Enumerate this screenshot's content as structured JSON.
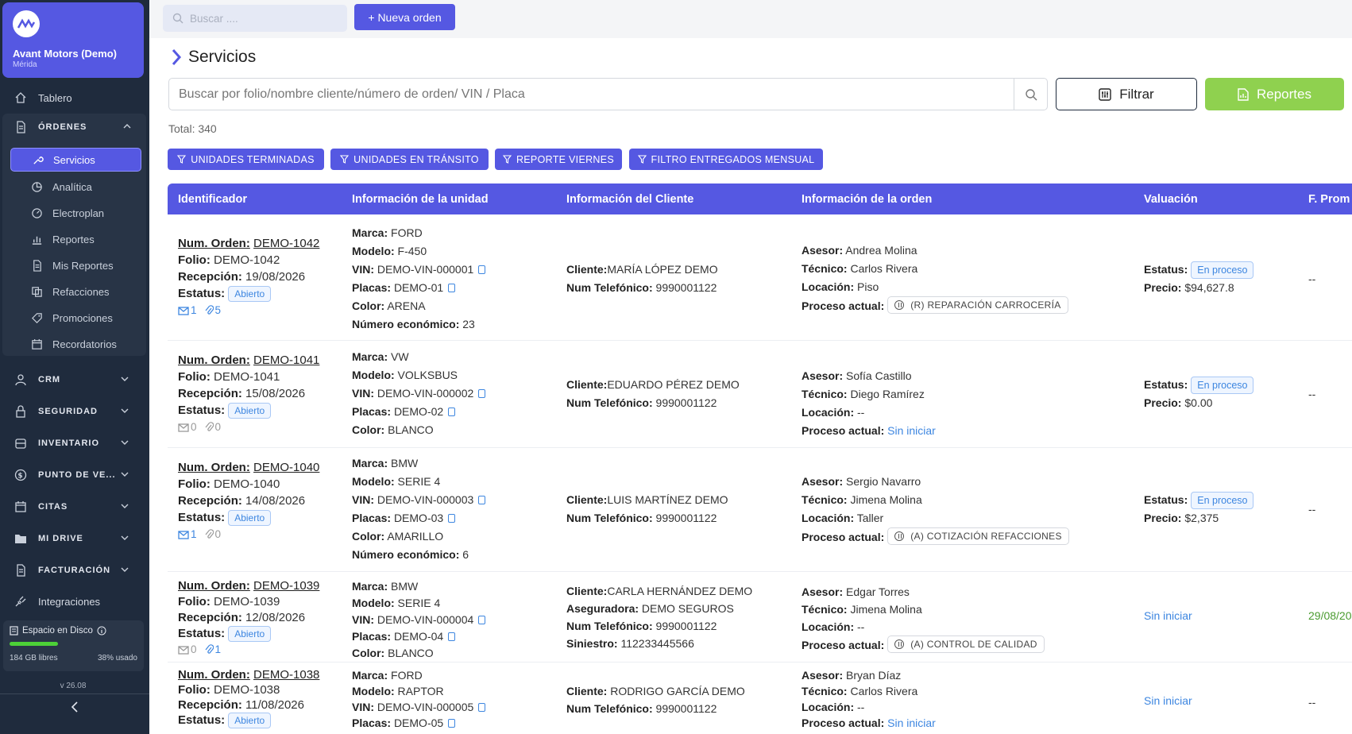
{
  "sidebar": {
    "company": "Avant Motors (Demo)",
    "city": "Mérida",
    "tablero": "Tablero",
    "ordenes": "ÓRDENES",
    "sub": [
      "Servicios",
      "Analítica",
      "Electroplan",
      "Reportes",
      "Mis Reportes",
      "Refacciones",
      "Promociones",
      "Recordatorios"
    ],
    "sections": [
      "CRM",
      "SEGURIDAD",
      "INVENTARIO",
      "PUNTO DE VE...",
      "CITAS",
      "MI DRIVE",
      "FACTURACIÓN"
    ],
    "integraciones": "Integraciones",
    "disk": {
      "title": "Espacio en Disco",
      "free": "184 GB libres",
      "used": "38% usado",
      "used_fraction": 0.38
    },
    "version": "v 26.08"
  },
  "topbar": {
    "search_placeholder": "Buscar ....",
    "new_order": "+ Nueva orden"
  },
  "page": {
    "title": "Servicios",
    "search_placeholder": "Buscar por folio/nombre cliente/número de orden/ VIN / Placa",
    "filter": "Filtrar",
    "reports": "Reportes",
    "total": "Total: 340",
    "quick_filters": [
      "UNIDADES TERMINADAS",
      "UNIDADES EN TRÁNSITO",
      "REPORTE VIERNES",
      "FILTRO ENTREGADOS MENSUAL"
    ]
  },
  "labels": {
    "num_orden": "Num. Orden:",
    "folio": "Folio:",
    "recepcion": "Recepción:",
    "estatus": "Estatus:",
    "marca": "Marca:",
    "modelo": "Modelo:",
    "vin": "VIN:",
    "placas": "Placas:",
    "color": "Color:",
    "num_eco": "Número económico:",
    "cliente": "Cliente:",
    "telefono": "Num Telefónico:",
    "aseguradora": "Aseguradora:",
    "siniestro": "Siniestro:",
    "asesor": "Asesor:",
    "tecnico": "Técnico:",
    "locacion": "Locación:",
    "proceso": "Proceso actual:",
    "precio": "Precio:"
  },
  "table": {
    "columns": [
      "Identificador",
      "Información de la unidad",
      "Información del Cliente",
      "Información de la orden",
      "Valuación",
      "F. Prom"
    ],
    "rows": [
      {
        "orden": "DEMO-1042",
        "folio": "DEMO-1042",
        "recepcion": "19/08/2026",
        "estatus": "Abierto",
        "mails": "1",
        "clips": "5",
        "marca": "FORD",
        "modelo": "F-450",
        "vin": "DEMO-VIN-000001",
        "placas": "DEMO-01",
        "color": "ARENA",
        "num_eco": "23",
        "cliente": "MARÍA LÓPEZ DEMO",
        "telefono": "9990001122",
        "asesor": "Andrea Molina",
        "tecnico": "Carlos Rivera",
        "locacion": "Piso",
        "proceso": "(R) REPARACIÓN CARROCERÍA",
        "val_estatus": "En proceso",
        "precio": "$94,627.8",
        "fprom": "--"
      },
      {
        "orden": "DEMO-1041",
        "folio": "DEMO-1041",
        "recepcion": "15/08/2026",
        "estatus": "Abierto",
        "mails": "0",
        "clips": "0",
        "marca": "VW",
        "modelo": "VOLKSBUS",
        "vin": "DEMO-VIN-000002",
        "placas": "DEMO-02",
        "color": "BLANCO",
        "cliente": "EDUARDO PÉREZ DEMO",
        "telefono": "9990001122",
        "asesor": "Sofía Castillo",
        "tecnico": "Diego Ramírez",
        "locacion": "--",
        "proceso_link": "Sin iniciar",
        "val_estatus": "En proceso",
        "precio": "$0.00",
        "fprom": "--"
      },
      {
        "orden": "DEMO-1040",
        "folio": "DEMO-1040",
        "recepcion": "14/08/2026",
        "estatus": "Abierto",
        "mails": "1",
        "clips": "0",
        "marca": "BMW",
        "modelo": "SERIE 4",
        "vin": "DEMO-VIN-000003",
        "placas": "DEMO-03",
        "color": "AMARILLO",
        "num_eco": "6",
        "cliente": "LUIS MARTÍNEZ DEMO",
        "telefono": "9990001122",
        "asesor": "Sergio Navarro",
        "tecnico": "Jimena Molina",
        "locacion": "Taller",
        "proceso": "(A) COTIZACIÓN REFACCIONES",
        "val_estatus": "En proceso",
        "precio": "$2,375",
        "fprom": "--"
      },
      {
        "orden": "DEMO-1039",
        "folio": "DEMO-1039",
        "recepcion": "12/08/2026",
        "estatus": "Abierto",
        "mails": "0",
        "clips": "1",
        "marca": "BMW",
        "modelo": "SERIE 4",
        "vin": "DEMO-VIN-000004",
        "placas": "DEMO-04",
        "color": "BLANCO",
        "cliente": "CARLA HERNÁNDEZ DEMO",
        "aseguradora": "DEMO SEGUROS",
        "telefono": "9990001122",
        "siniestro": "112233445566",
        "asesor": "Edgar Torres",
        "tecnico": "Jimena Molina",
        "locacion": "--",
        "proceso": "(A) CONTROL DE CALIDAD",
        "val_link": "Sin iniciar",
        "fprom": "29/08/20"
      },
      {
        "orden": "DEMO-1038",
        "folio": "DEMO-1038",
        "recepcion": "11/08/2026",
        "estatus": "Abierto",
        "marca": "FORD",
        "modelo": "RAPTOR",
        "vin": "DEMO-VIN-000005",
        "placas": "DEMO-05",
        "cliente": "RODRIGO GARCÍA DEMO",
        "telefono": "9990001122",
        "asesor": "Bryan Díaz",
        "tecnico": "Carlos Rivera",
        "locacion": "--",
        "proceso_link": "Sin iniciar",
        "val_link": "Sin iniciar",
        "fprom": "--"
      }
    ]
  }
}
